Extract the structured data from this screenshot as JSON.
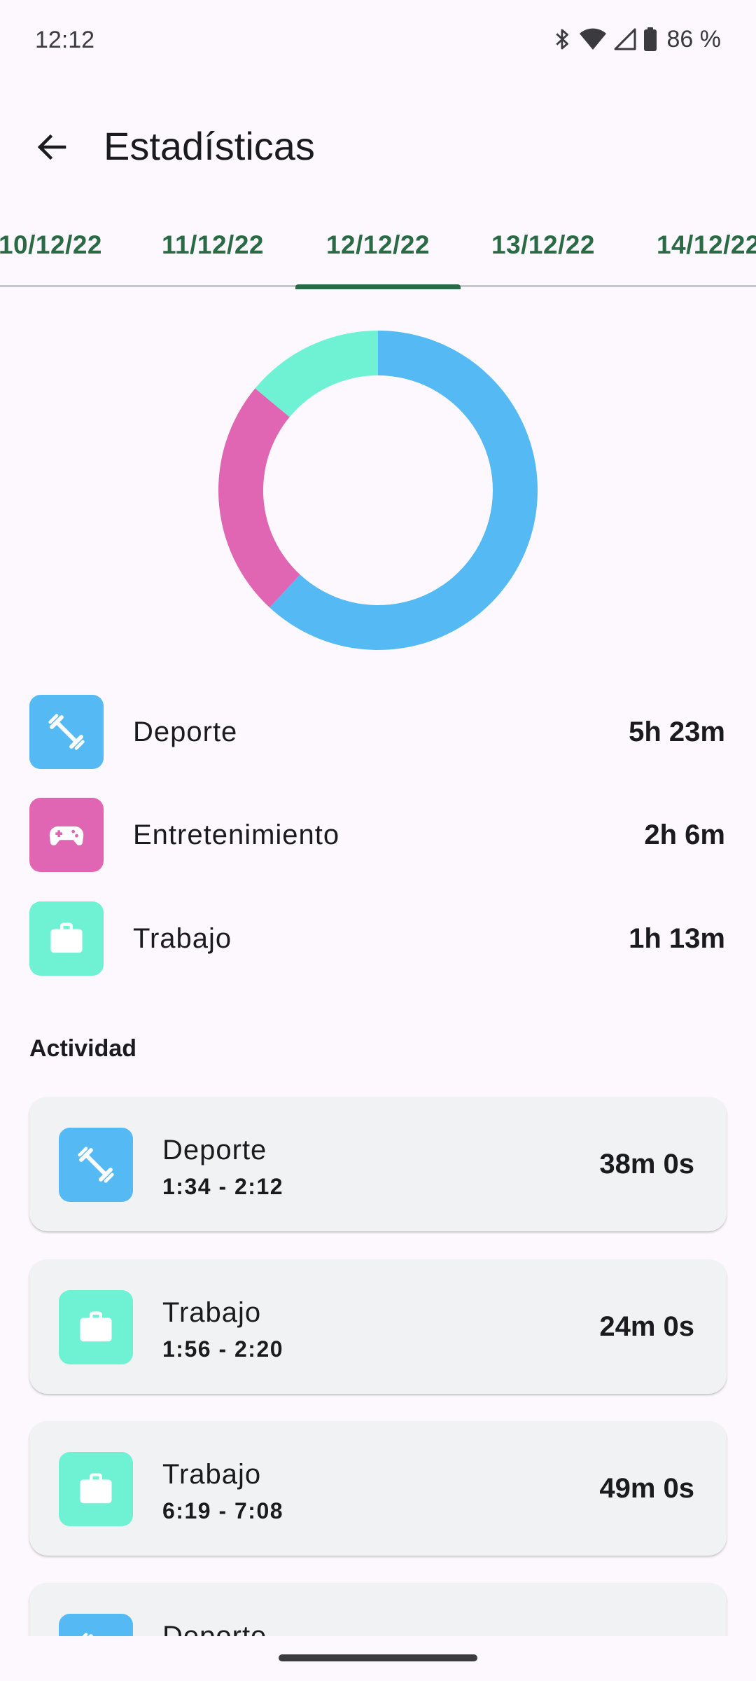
{
  "status_bar": {
    "time": "12:12",
    "battery": "86 %"
  },
  "app_bar": {
    "title": "Estadísticas"
  },
  "tabs": [
    {
      "label": "10/12/22",
      "active": false
    },
    {
      "label": "11/12/22",
      "active": false
    },
    {
      "label": "12/12/22",
      "active": true
    },
    {
      "label": "13/12/22",
      "active": false
    },
    {
      "label": "14/12/22",
      "active": false
    }
  ],
  "colors": {
    "deporte": "#55B9F3",
    "entretenimiento": "#E066B3",
    "trabajo": "#6FF1D4",
    "accent": "#2A6B45"
  },
  "categories": [
    {
      "name": "Deporte",
      "total": "5h 23m",
      "icon": "dumbbell-icon"
    },
    {
      "name": "Entretenimiento",
      "total": "2h 6m",
      "icon": "gamepad-icon"
    },
    {
      "name": "Trabajo",
      "total": "1h 13m",
      "icon": "briefcase-icon"
    }
  ],
  "chart_data": {
    "type": "pie",
    "categories": [
      "Deporte",
      "Entretenimiento",
      "Trabajo"
    ],
    "values": [
      323,
      126,
      73
    ]
  },
  "activity": {
    "title": "Actividad",
    "items": [
      {
        "name": "Deporte",
        "time": "1:34 - 2:12",
        "duration": "38m 0s",
        "icon": "dumbbell-icon"
      },
      {
        "name": "Trabajo",
        "time": "1:56 - 2:20",
        "duration": "24m 0s",
        "icon": "briefcase-icon"
      },
      {
        "name": "Trabajo",
        "time": "6:19 - 7:08",
        "duration": "49m 0s",
        "icon": "briefcase-icon"
      },
      {
        "name": "Deporte",
        "time": "",
        "duration": "",
        "icon": "dumbbell-icon"
      }
    ]
  }
}
